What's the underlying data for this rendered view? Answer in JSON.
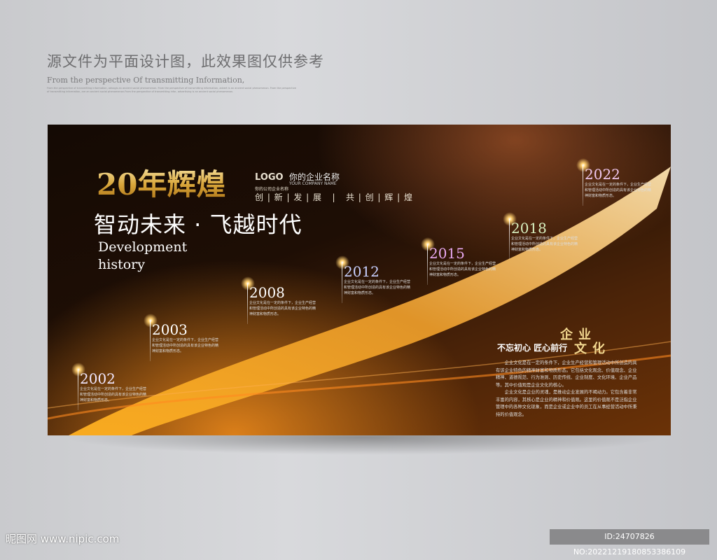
{
  "header": {
    "title_cn": "源文件为平面设计图，此效果图仅供参考",
    "subtitle_en": "From the perspective Of transmitting Information,",
    "fine_print": "From the perspective of transmitting information, advogis an ancient social phenomenon. From the perspective of transmitting information, advert is an ancient social phenomenon. From the perspective of transmitting information, are an ancient social phenomenon.From the perspective of transmitting infor, advertising is an ancient social phenomenon."
  },
  "poster": {
    "title": "20年辉煌",
    "logo": "LOGO",
    "logo_sub": "你的公司企业名称",
    "company_name": "你的企业名称",
    "company_name_en": "YOUR COMPANY NAME",
    "slogan": "创 | 新 | 发 | 展   |   共 | 创 | 辉 | 煌",
    "subtitle": "智动未来 · 飞越时代",
    "dev_line1": "Development",
    "dev_line2": "history",
    "milestones": [
      {
        "year": "2002",
        "text": "企业文化是在一定的条件下，企业生产经营和管理活动中所创造的具有该企业特色的精神财富和物质形态。",
        "color": "#f2e8ff"
      },
      {
        "year": "2003",
        "text": "企业文化是在一定的条件下，企业生产经营和管理活动中所创造的具有该企业特色的精神财富和物质形态。",
        "color": "#ffffff"
      },
      {
        "year": "2008",
        "text": "企业文化是在一定的条件下，企业生产经营和管理活动中所创造的具有该企业特色的精神财富和物质形态。",
        "color": "#ffffff"
      },
      {
        "year": "2012",
        "text": "企业文化是在一定的条件下，企业生产经营和管理活动中所创造的具有该企业特色的精神财富和物质形态。",
        "color": "#c8d0ff"
      },
      {
        "year": "2015",
        "text": "企业文化是在一定的条件下，企业生产经营和管理活动中所创造的具有该企业特色的精神财富和物质形态。",
        "color": "#e8a8f0"
      },
      {
        "year": "2018",
        "text": "企业文化是在一定的条件下，企业生产经营和管理活动中所创造的具有该企业特色的精神财富和物质形态。",
        "color": "#d8f0c0"
      },
      {
        "year": "2022",
        "text": "企业文化是在一定的条件下，企业生产经营和管理活动中所创造的具有该企业特色的精神财富和物质形态。",
        "color": "#f0c8f0"
      }
    ],
    "culture": {
      "motto": "不忘初心 匠心前行",
      "title1": "企业",
      "title2": "文化",
      "para1": "企业文化是在一定的条件下，企业生产经营和管理活动中所创造的具有该企业特色的精神财富和物质形态。它包括文化观念、价值观念、企业精神、道德规范、行为准则、历史传统、企业制度、文化环境、企业产品等。其中价值观是企业文化的核心。",
      "para2": "企业文化是企业的灵魂，是推动企业发展的不竭动力。它包含着非常丰富的内容，其核心是企业的精神和价值观。这里的价值观不是泛指企业管理中的各种文化现象，而是企业或企业中的员工在从事经营活动中所秉持的价值观念。"
    }
  },
  "watermark": {
    "site": "昵图网 www.nipic.com",
    "id": "ID:24707826 NO:20221219180853386109"
  }
}
